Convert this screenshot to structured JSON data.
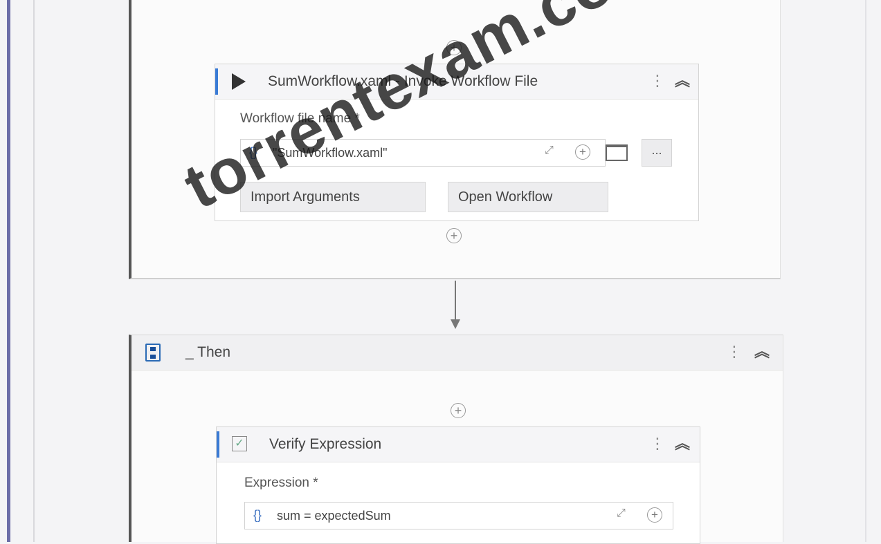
{
  "invoke_card": {
    "title": "SumWorkflow.xaml - Invoke Workflow File",
    "field_label": "Workflow file name *",
    "braces": "{}",
    "file_value": "\"SumWorkflow.xaml\"",
    "ellipsis": "...",
    "import_button": "Import Arguments",
    "open_button": "Open Workflow"
  },
  "then_sequence": {
    "title": "_ Then"
  },
  "verify_card": {
    "title": "Verify Expression",
    "field_label": "Expression *",
    "braces": "{}",
    "expression_value": "sum = expectedSum"
  },
  "watermark": "torrentexam.com",
  "colors": {
    "accent": "#3a7bd5",
    "left_bar": "#6c6ea8"
  }
}
